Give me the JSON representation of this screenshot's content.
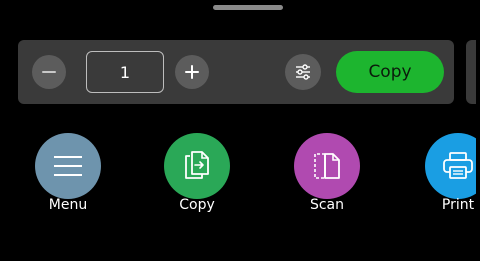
{
  "quantity": {
    "value": "1",
    "decrement_icon": "minus-icon",
    "increment_icon": "plus-icon"
  },
  "settings_icon": "sliders-icon",
  "primary_action": {
    "label": "Copy",
    "color": "#1db52f"
  },
  "apps": [
    {
      "label": "Menu",
      "icon": "hamburger-icon",
      "color": "#6e94ad"
    },
    {
      "label": "Copy",
      "icon": "copy-document-icon",
      "color": "#2aa857"
    },
    {
      "label": "Scan",
      "icon": "scan-document-icon",
      "color": "#b04ab0"
    },
    {
      "label": "Print",
      "icon": "printer-icon",
      "color": "#1a9ee3"
    }
  ]
}
